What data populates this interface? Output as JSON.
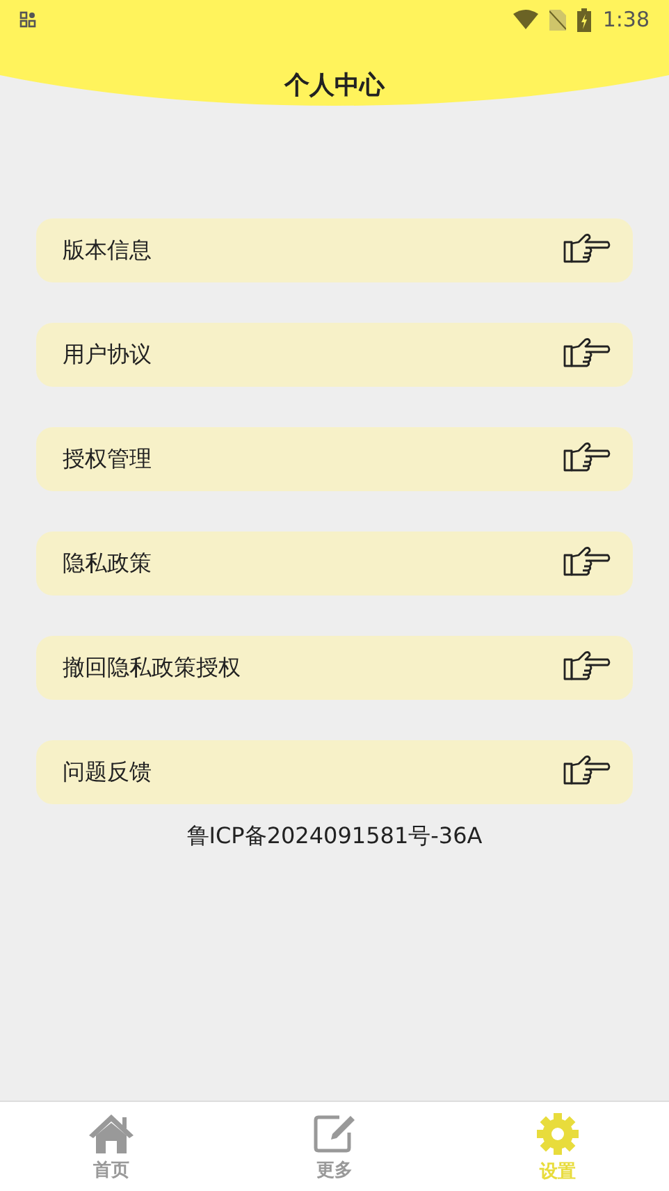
{
  "status_bar": {
    "time": "1:38"
  },
  "header": {
    "title": "个人中心"
  },
  "menu": [
    {
      "label": "版本信息"
    },
    {
      "label": "用户协议"
    },
    {
      "label": "授权管理"
    },
    {
      "label": "隐私政策"
    },
    {
      "label": "撤回隐私政策授权"
    },
    {
      "label": "问题反馈"
    }
  ],
  "footer_note": "鲁ICP备2024091581号-36A",
  "tabs": [
    {
      "label": "首页",
      "kind": "home",
      "selected": false
    },
    {
      "label": "更多",
      "kind": "edit",
      "selected": false
    },
    {
      "label": "设置",
      "kind": "gear",
      "selected": true
    }
  ]
}
